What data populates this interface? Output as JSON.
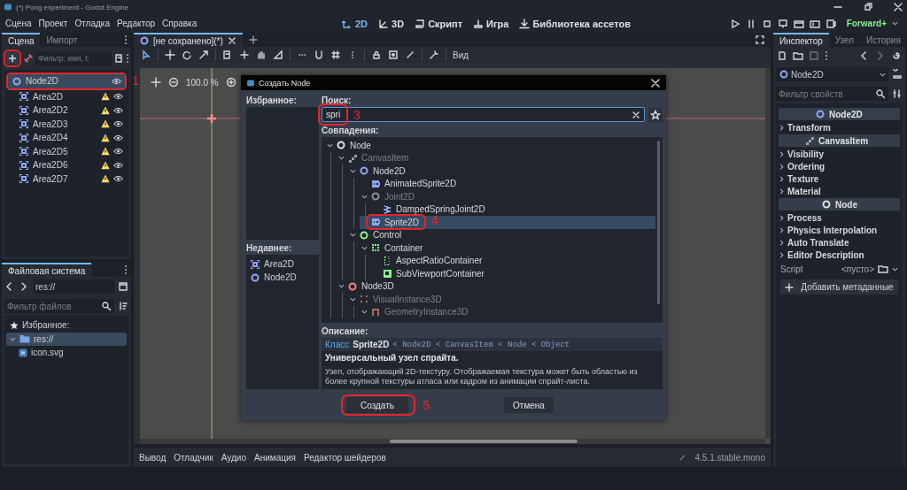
{
  "window": {
    "title": "(*) Pong experiment - Godot Engine"
  },
  "menu": [
    "Сцена",
    "Проект",
    "Отладка",
    "Редактор",
    "Справка"
  ],
  "workspaces": [
    {
      "label": "2D",
      "kind": "canvas",
      "selected": true
    },
    {
      "label": "3D",
      "kind": "spatial",
      "selected": false
    },
    {
      "label": "Скрипт",
      "kind": "script",
      "selected": false
    },
    {
      "label": "Игра",
      "kind": "game",
      "selected": false
    },
    {
      "label": "Библиотека ассетов",
      "kind": "assetlib",
      "selected": false
    }
  ],
  "renderer": "Forward+",
  "scene_dock": {
    "tabs": [
      {
        "label": "Сцена",
        "selected": true
      },
      {
        "label": "Импорт",
        "selected": false
      }
    ],
    "add_button": {
      "circled": true
    },
    "filter_placeholder": "Фильтр: имя, t:",
    "tree": {
      "label": "Node2D",
      "kind": "node",
      "selected": true,
      "circled": true,
      "callout": "1",
      "children": [
        {
          "label": "Area2D",
          "kind": "area",
          "warning": true,
          "selected": false
        },
        {
          "label": "Area2D2",
          "kind": "area",
          "warning": true,
          "selected": false
        },
        {
          "label": "Area2D3",
          "kind": "area",
          "warning": true,
          "selected": false
        },
        {
          "label": "Area2D4",
          "kind": "area",
          "warning": true,
          "selected": false
        },
        {
          "label": "Area2D5",
          "kind": "area",
          "warning": true,
          "selected": false
        },
        {
          "label": "Area2D6",
          "kind": "area",
          "warning": true,
          "selected": false
        },
        {
          "label": "Area2D7",
          "kind": "area",
          "warning": true,
          "selected": false
        }
      ]
    }
  },
  "filesystem": {
    "tab": "Файловая система",
    "path": "res://",
    "filter_placeholder": "Фильтр файлов",
    "favorites": "Избранное:",
    "tree": [
      {
        "label": "res://",
        "kind": "folder",
        "selected": true,
        "expanded": true,
        "children": [
          {
            "label": "icon.svg",
            "kind": "file",
            "selected": false
          }
        ]
      }
    ]
  },
  "editor": {
    "tabs": [
      {
        "label": "[не сохранено](*)",
        "selected": true
      }
    ],
    "view_menu": "Вид",
    "zoom": "100.0 %",
    "bottom_tabs": [
      "Вывод",
      "Отладчик",
      "Аудио",
      "Анимация",
      "Редактор шейдеров"
    ],
    "version": "4.5.1.stable.mono"
  },
  "dialog": {
    "title": "Создать Node",
    "favorites_label": "Избранное:",
    "recent_label": "Недавнее:",
    "recent": [
      {
        "label": "Area2D",
        "kind": "area"
      },
      {
        "label": "Node2D",
        "kind": "node"
      }
    ],
    "search_label": "Поиск:",
    "search_value": "spri",
    "search_circled": true,
    "search_callout": "3",
    "matches_label": "Совпадения:",
    "tree": [
      {
        "label": "Node",
        "kind": "node",
        "color": "#e0e0e0",
        "expanded": true,
        "disabled": false,
        "selected": false,
        "children": [
          {
            "label": "CanvasItem",
            "kind": "pencil",
            "color": "#a0a0a0",
            "expanded": true,
            "disabled": true,
            "selected": false,
            "children": [
              {
                "label": "Node2D",
                "kind": "node",
                "color": "#8da5f3",
                "expanded": true,
                "disabled": false,
                "selected": false,
                "children": [
                  {
                    "label": "AnimatedSprite2D",
                    "kind": "sprite",
                    "color": "#8da5f3",
                    "disabled": false,
                    "selected": false
                  },
                  {
                    "label": "Joint2D",
                    "kind": "node",
                    "color": "#8a8f99",
                    "expanded": true,
                    "disabled": true,
                    "selected": false,
                    "children": [
                      {
                        "label": "DampedSpringJoint2D",
                        "kind": "spring",
                        "color": "#8da5f3",
                        "disabled": false,
                        "selected": false
                      }
                    ]
                  },
                  {
                    "label": "Sprite2D",
                    "kind": "sprite",
                    "color": "#8da5f3",
                    "disabled": false,
                    "selected": true,
                    "circled": true,
                    "callout": "4"
                  }
                ]
              },
              {
                "label": "Control",
                "kind": "node",
                "color": "#8eef97",
                "expanded": true,
                "disabled": false,
                "selected": false,
                "children": [
                  {
                    "label": "Container",
                    "kind": "dashed",
                    "color": "#8eef97",
                    "expanded": true,
                    "disabled": false,
                    "selected": false,
                    "children": [
                      {
                        "label": "AspectRatioContainer",
                        "kind": "aspect",
                        "color": "#8eef97",
                        "disabled": false,
                        "selected": false
                      },
                      {
                        "label": "SubViewportContainer",
                        "kind": "subviewport",
                        "color": "#8eef97",
                        "disabled": false,
                        "selected": false
                      }
                    ]
                  }
                ]
              }
            ]
          },
          {
            "label": "Node3D",
            "kind": "node",
            "color": "#fc7f7f",
            "expanded": true,
            "disabled": false,
            "selected": false,
            "children": [
              {
                "label": "VisualInstance3D",
                "kind": "dots",
                "color": "#b06a6a",
                "expanded": true,
                "disabled": true,
                "selected": false,
                "children": [
                  {
                    "label": "GeometryInstance3D",
                    "kind": "geometry",
                    "color": "#b06a6a",
                    "expanded": true,
                    "disabled": true,
                    "selected": false
                  }
                ]
              }
            ]
          }
        ]
      }
    ],
    "description_label": "Описание:",
    "class_word": "Класс",
    "class_name": "Sprite2D",
    "inheritance": "< Node2D < CanvasItem < Node < Object",
    "summary": "Универсальный узел спрайта.",
    "body": "Узел, отображающий 2D-текстуру. Отображаемая текстура может быть областью из более крупной текстуры атласа или кадром из анимации спрайт-листа.",
    "create_button": "Создать",
    "create_circled": true,
    "create_callout": "5",
    "cancel_button": "Отмена"
  },
  "inspector": {
    "tabs": [
      {
        "label": "Инспектор",
        "selected": true
      },
      {
        "label": "Узел",
        "selected": false
      },
      {
        "label": "История",
        "selected": false
      }
    ],
    "node": "Node2D",
    "filter_placeholder": "Фильтр свойств",
    "sections": [
      {
        "kind": "header",
        "label": "Node2D"
      },
      {
        "kind": "group",
        "label": "Transform"
      },
      {
        "kind": "header",
        "label": "CanvasItem"
      },
      {
        "kind": "group",
        "label": "Visibility"
      },
      {
        "kind": "group",
        "label": "Ordering"
      },
      {
        "kind": "group",
        "label": "Texture"
      },
      {
        "kind": "group",
        "label": "Material"
      },
      {
        "kind": "header",
        "label": "Node"
      },
      {
        "kind": "group",
        "label": "Process"
      },
      {
        "kind": "group",
        "label": "Physics Interpolation"
      },
      {
        "kind": "group",
        "label": "Auto Translate"
      },
      {
        "kind": "group",
        "label": "Editor Description"
      }
    ],
    "script_label": "Script",
    "script_value": "<пусто>",
    "add_meta": "Добавить метаданные"
  }
}
